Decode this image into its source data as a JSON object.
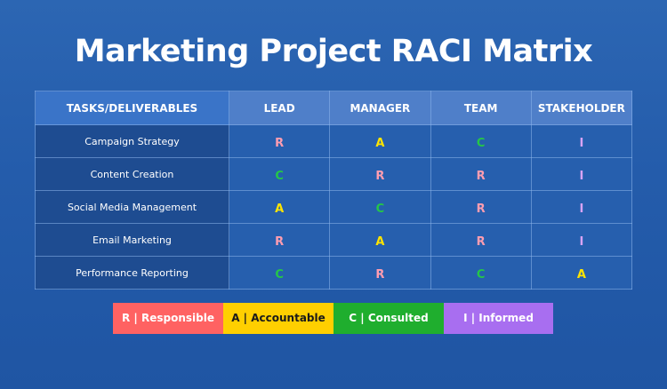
{
  "title": "Marketing Project RACI Matrix",
  "columns": [
    "TASKS/DELIVERABLES",
    "LEAD",
    "MANAGER",
    "TEAM",
    "STAKEHOLDER"
  ],
  "rows": [
    {
      "task": "Campaign Strategy",
      "cells": [
        "R",
        "A",
        "C",
        "I"
      ]
    },
    {
      "task": "Content Creation",
      "cells": [
        "C",
        "R",
        "R",
        "I"
      ]
    },
    {
      "task": "Social Media Management",
      "cells": [
        "A",
        "C",
        "R",
        "I"
      ]
    },
    {
      "task": "Email Marketing",
      "cells": [
        "R",
        "A",
        "R",
        "I"
      ]
    },
    {
      "task": "Performance Reporting",
      "cells": [
        "C",
        "R",
        "C",
        "A"
      ]
    }
  ],
  "legend": [
    {
      "code": "R",
      "label": "R | Responsible",
      "color": "#ff6262"
    },
    {
      "code": "A",
      "label": "A | Accountable",
      "color": "#ffcf00"
    },
    {
      "code": "C",
      "label": "C | Consulted",
      "color": "#1fae2e"
    },
    {
      "code": "I",
      "label": "I | Informed",
      "color": "#a86ef0"
    }
  ],
  "code_colors": {
    "R": "#ff9db0",
    "A": "#ffe400",
    "C": "#25c648",
    "I": "#d8a3f4"
  }
}
